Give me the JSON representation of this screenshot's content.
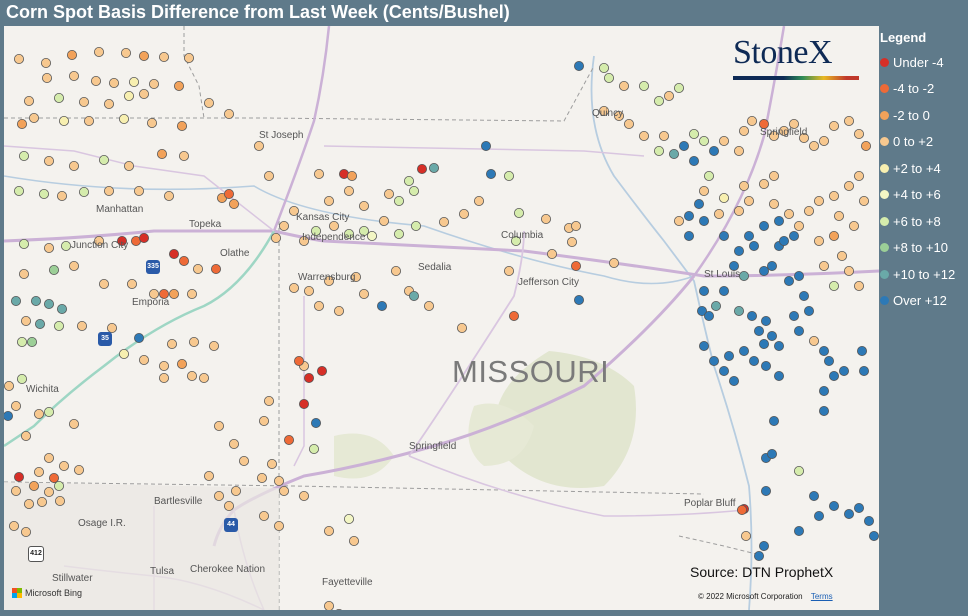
{
  "header": {
    "title": "Corn Spot Basis Difference from Last Week (Cents/Bushel)"
  },
  "brand": {
    "logo_text": "StoneX"
  },
  "legend": {
    "title": "Legend",
    "items": [
      {
        "label": "Under -4",
        "color": "#d62f27"
      },
      {
        "label": "-4 to -2",
        "color": "#ee6a37"
      },
      {
        "label": "-2 to 0",
        "color": "#f2a25a"
      },
      {
        "label": "0 to +2",
        "color": "#f7c88f"
      },
      {
        "label": "+2 to +4",
        "color": "#f7efb0"
      },
      {
        "label": "+4 to +6",
        "color": "#f3f6c4"
      },
      {
        "label": "+6 to +8",
        "color": "#d5ecac"
      },
      {
        "label": "+8 to +10",
        "color": "#9ccf97"
      },
      {
        "label": "+10 to +12",
        "color": "#6aa9a8"
      },
      {
        "label": "Over +12",
        "color": "#2d79b6"
      }
    ]
  },
  "map": {
    "state_label": "MISSOURI",
    "places": [
      {
        "name": "St Joseph"
      },
      {
        "name": "Manhattan"
      },
      {
        "name": "Topeka"
      },
      {
        "name": "Kansas City"
      },
      {
        "name": "Independence"
      },
      {
        "name": "Junction City"
      },
      {
        "name": "Olathe"
      },
      {
        "name": "Columbia"
      },
      {
        "name": "Sedalia"
      },
      {
        "name": "Warrensburg"
      },
      {
        "name": "Jefferson City"
      },
      {
        "name": "St Louis"
      },
      {
        "name": "Emporia"
      },
      {
        "name": "Springfield"
      },
      {
        "name": "Wichita"
      },
      {
        "name": "Bartlesville"
      },
      {
        "name": "Osage I.R."
      },
      {
        "name": "Poplar Bluff"
      },
      {
        "name": "Stillwater"
      },
      {
        "name": "Tulsa"
      },
      {
        "name": "Cherokee Nation"
      },
      {
        "name": "Fayetteville"
      },
      {
        "name": "Quincy"
      },
      {
        "name": "Springfield"
      }
    ],
    "shields": [
      "35",
      "335",
      "35",
      "44",
      "412"
    ],
    "source": "Source: DTN ProphetX",
    "copyright": "© 2022 Microsoft Corporation",
    "terms": "Terms",
    "attribution": "Microsoft Bing"
  },
  "sites": [
    [
      15,
      33,
      3
    ],
    [
      42,
      37,
      3
    ],
    [
      68,
      29,
      2
    ],
    [
      95,
      26,
      3
    ],
    [
      122,
      27,
      3
    ],
    [
      140,
      30,
      2
    ],
    [
      160,
      31,
      3
    ],
    [
      185,
      32,
      3
    ],
    [
      43,
      52,
      3
    ],
    [
      70,
      50,
      3
    ],
    [
      92,
      55,
      3
    ],
    [
      110,
      57,
      3
    ],
    [
      130,
      56,
      4
    ],
    [
      150,
      58,
      3
    ],
    [
      175,
      60,
      2
    ],
    [
      25,
      75,
      3
    ],
    [
      55,
      72,
      6
    ],
    [
      80,
      76,
      3
    ],
    [
      105,
      78,
      3
    ],
    [
      125,
      70,
      4
    ],
    [
      140,
      68,
      3
    ],
    [
      18,
      98,
      2
    ],
    [
      30,
      92,
      3
    ],
    [
      60,
      95,
      4
    ],
    [
      85,
      95,
      3
    ],
    [
      120,
      93,
      4
    ],
    [
      148,
      97,
      3
    ],
    [
      178,
      100,
      2
    ],
    [
      205,
      77,
      3
    ],
    [
      225,
      88,
      3
    ],
    [
      20,
      130,
      6
    ],
    [
      45,
      135,
      3
    ],
    [
      70,
      140,
      3
    ],
    [
      100,
      134,
      6
    ],
    [
      125,
      140,
      3
    ],
    [
      158,
      128,
      2
    ],
    [
      180,
      130,
      3
    ],
    [
      15,
      165,
      6
    ],
    [
      40,
      168,
      6
    ],
    [
      58,
      170,
      3
    ],
    [
      80,
      166,
      6
    ],
    [
      105,
      165,
      3
    ],
    [
      135,
      165,
      3
    ],
    [
      165,
      170,
      3
    ],
    [
      218,
      172,
      2
    ],
    [
      230,
      178,
      2
    ],
    [
      225,
      168,
      1
    ],
    [
      20,
      218,
      6
    ],
    [
      45,
      222,
      3
    ],
    [
      62,
      220,
      6
    ],
    [
      95,
      215,
      3
    ],
    [
      118,
      215,
      0
    ],
    [
      132,
      215,
      1
    ],
    [
      140,
      212,
      0
    ],
    [
      170,
      228,
      0
    ],
    [
      180,
      235,
      1
    ],
    [
      212,
      243,
      1
    ],
    [
      194,
      243,
      3
    ],
    [
      20,
      248,
      3
    ],
    [
      50,
      244,
      7
    ],
    [
      70,
      240,
      3
    ],
    [
      100,
      258,
      3
    ],
    [
      128,
      258,
      3
    ],
    [
      150,
      268,
      3
    ],
    [
      160,
      268,
      1
    ],
    [
      170,
      268,
      2
    ],
    [
      188,
      268,
      3
    ],
    [
      12,
      275,
      8
    ],
    [
      32,
      275,
      8
    ],
    [
      45,
      278,
      8
    ],
    [
      58,
      283,
      8
    ],
    [
      22,
      295,
      3
    ],
    [
      36,
      298,
      8
    ],
    [
      55,
      300,
      6
    ],
    [
      78,
      300,
      3
    ],
    [
      108,
      302,
      3
    ],
    [
      18,
      316,
      6
    ],
    [
      28,
      316,
      7
    ],
    [
      135,
      312,
      9
    ],
    [
      168,
      318,
      3
    ],
    [
      190,
      316,
      3
    ],
    [
      210,
      320,
      3
    ],
    [
      120,
      328,
      4
    ],
    [
      140,
      334,
      3
    ],
    [
      160,
      340,
      3
    ],
    [
      178,
      338,
      2
    ],
    [
      188,
      350,
      3
    ],
    [
      160,
      352,
      3
    ],
    [
      200,
      352,
      3
    ],
    [
      5,
      360,
      3
    ],
    [
      18,
      353,
      6
    ],
    [
      12,
      380,
      3
    ],
    [
      35,
      388,
      3
    ],
    [
      45,
      386,
      6
    ],
    [
      70,
      398,
      3
    ],
    [
      22,
      410,
      3
    ],
    [
      45,
      432,
      3
    ],
    [
      60,
      440,
      3
    ],
    [
      75,
      444,
      3
    ],
    [
      35,
      446,
      3
    ],
    [
      50,
      452,
      1
    ],
    [
      15,
      451,
      0
    ],
    [
      30,
      460,
      2
    ],
    [
      12,
      465,
      3
    ],
    [
      45,
      466,
      3
    ],
    [
      55,
      460,
      6
    ],
    [
      25,
      478,
      3
    ],
    [
      38,
      476,
      3
    ],
    [
      56,
      475,
      3
    ],
    [
      10,
      500,
      3
    ],
    [
      22,
      506,
      3
    ],
    [
      4,
      390,
      9
    ],
    [
      255,
      120,
      3
    ],
    [
      265,
      150,
      3
    ],
    [
      315,
      148,
      3
    ],
    [
      340,
      148,
      0
    ],
    [
      348,
      150,
      2
    ],
    [
      345,
      165,
      3
    ],
    [
      405,
      155,
      6
    ],
    [
      418,
      143,
      0
    ],
    [
      430,
      142,
      8
    ],
    [
      410,
      165,
      6
    ],
    [
      395,
      175,
      6
    ],
    [
      385,
      168,
      3
    ],
    [
      360,
      180,
      3
    ],
    [
      325,
      175,
      3
    ],
    [
      290,
      185,
      3
    ],
    [
      272,
      212,
      3
    ],
    [
      280,
      200,
      3
    ],
    [
      300,
      215,
      3
    ],
    [
      312,
      205,
      6
    ],
    [
      330,
      200,
      3
    ],
    [
      345,
      208,
      6
    ],
    [
      360,
      205,
      6
    ],
    [
      368,
      210,
      5
    ],
    [
      380,
      195,
      3
    ],
    [
      395,
      208,
      6
    ],
    [
      412,
      200,
      6
    ],
    [
      440,
      196,
      3
    ],
    [
      460,
      188,
      3
    ],
    [
      482,
      120,
      9
    ],
    [
      505,
      150,
      6
    ],
    [
      487,
      148,
      9
    ],
    [
      475,
      175,
      3
    ],
    [
      515,
      187,
      6
    ],
    [
      542,
      193,
      3
    ],
    [
      565,
      202,
      3
    ],
    [
      572,
      200,
      3
    ],
    [
      548,
      228,
      3
    ],
    [
      568,
      216,
      3
    ],
    [
      572,
      240,
      1
    ],
    [
      512,
      215,
      6
    ],
    [
      505,
      245,
      3
    ],
    [
      392,
      245,
      3
    ],
    [
      352,
      251,
      3
    ],
    [
      325,
      255,
      3
    ],
    [
      305,
      265,
      3
    ],
    [
      290,
      262,
      3
    ],
    [
      315,
      280,
      3
    ],
    [
      335,
      285,
      3
    ],
    [
      360,
      268,
      3
    ],
    [
      378,
      280,
      9
    ],
    [
      405,
      265,
      3
    ],
    [
      410,
      270,
      8
    ],
    [
      425,
      280,
      3
    ],
    [
      458,
      302,
      3
    ],
    [
      510,
      290,
      1
    ],
    [
      575,
      274,
      9
    ],
    [
      610,
      237,
      3
    ],
    [
      300,
      340,
      3
    ],
    [
      295,
      335,
      1
    ],
    [
      318,
      345,
      0
    ],
    [
      305,
      352,
      0
    ],
    [
      300,
      378,
      0
    ],
    [
      312,
      397,
      9
    ],
    [
      285,
      414,
      1
    ],
    [
      310,
      423,
      6
    ],
    [
      260,
      395,
      3
    ],
    [
      265,
      375,
      3
    ],
    [
      268,
      438,
      3
    ],
    [
      258,
      452,
      3
    ],
    [
      240,
      435,
      3
    ],
    [
      230,
      418,
      3
    ],
    [
      215,
      400,
      3
    ],
    [
      205,
      450,
      3
    ],
    [
      215,
      470,
      3
    ],
    [
      225,
      480,
      3
    ],
    [
      232,
      465,
      3
    ],
    [
      275,
      455,
      3
    ],
    [
      280,
      465,
      3
    ],
    [
      300,
      470,
      3
    ],
    [
      260,
      490,
      3
    ],
    [
      275,
      500,
      3
    ],
    [
      325,
      505,
      3
    ],
    [
      345,
      493,
      5
    ],
    [
      350,
      515,
      3
    ],
    [
      325,
      580,
      3
    ],
    [
      335,
      588,
      3
    ],
    [
      575,
      40,
      9
    ],
    [
      600,
      42,
      6
    ],
    [
      605,
      52,
      6
    ],
    [
      620,
      60,
      3
    ],
    [
      640,
      60,
      6
    ],
    [
      655,
      75,
      6
    ],
    [
      665,
      70,
      3
    ],
    [
      675,
      62,
      6
    ],
    [
      600,
      85,
      3
    ],
    [
      615,
      90,
      3
    ],
    [
      625,
      98,
      3
    ],
    [
      640,
      110,
      3
    ],
    [
      660,
      110,
      3
    ],
    [
      655,
      125,
      6
    ],
    [
      670,
      128,
      8
    ],
    [
      680,
      120,
      9
    ],
    [
      690,
      108,
      6
    ],
    [
      700,
      115,
      6
    ],
    [
      710,
      125,
      9
    ],
    [
      720,
      115,
      3
    ],
    [
      735,
      125,
      3
    ],
    [
      740,
      105,
      3
    ],
    [
      748,
      95,
      3
    ],
    [
      760,
      98,
      1
    ],
    [
      770,
      110,
      3
    ],
    [
      780,
      105,
      3
    ],
    [
      790,
      98,
      3
    ],
    [
      800,
      112,
      3
    ],
    [
      810,
      120,
      3
    ],
    [
      820,
      115,
      3
    ],
    [
      830,
      100,
      3
    ],
    [
      845,
      95,
      3
    ],
    [
      855,
      108,
      3
    ],
    [
      862,
      120,
      2
    ],
    [
      690,
      135,
      9
    ],
    [
      705,
      150,
      6
    ],
    [
      700,
      165,
      3
    ],
    [
      695,
      178,
      9
    ],
    [
      685,
      190,
      9
    ],
    [
      675,
      195,
      3
    ],
    [
      700,
      195,
      9
    ],
    [
      715,
      188,
      3
    ],
    [
      720,
      172,
      4
    ],
    [
      740,
      160,
      3
    ],
    [
      745,
      175,
      3
    ],
    [
      735,
      185,
      3
    ],
    [
      760,
      158,
      3
    ],
    [
      770,
      150,
      3
    ],
    [
      770,
      178,
      3
    ],
    [
      760,
      200,
      9
    ],
    [
      775,
      195,
      9
    ],
    [
      785,
      188,
      3
    ],
    [
      795,
      200,
      3
    ],
    [
      805,
      185,
      3
    ],
    [
      815,
      175,
      3
    ],
    [
      830,
      170,
      3
    ],
    [
      845,
      160,
      3
    ],
    [
      855,
      150,
      3
    ],
    [
      860,
      175,
      3
    ],
    [
      835,
      190,
      3
    ],
    [
      850,
      200,
      3
    ],
    [
      830,
      210,
      2
    ],
    [
      815,
      215,
      3
    ],
    [
      685,
      210,
      9
    ],
    [
      720,
      210,
      9
    ],
    [
      735,
      225,
      9
    ],
    [
      745,
      210,
      9
    ],
    [
      750,
      220,
      9
    ],
    [
      730,
      240,
      9
    ],
    [
      740,
      250,
      8
    ],
    [
      760,
      245,
      9
    ],
    [
      768,
      240,
      9
    ],
    [
      775,
      220,
      9
    ],
    [
      780,
      215,
      9
    ],
    [
      790,
      210,
      9
    ],
    [
      785,
      255,
      9
    ],
    [
      795,
      250,
      9
    ],
    [
      820,
      240,
      3
    ],
    [
      838,
      230,
      3
    ],
    [
      845,
      245,
      3
    ],
    [
      855,
      260,
      3
    ],
    [
      830,
      260,
      6
    ],
    [
      800,
      270,
      9
    ],
    [
      805,
      285,
      9
    ],
    [
      790,
      290,
      9
    ],
    [
      795,
      305,
      9
    ],
    [
      810,
      315,
      3
    ],
    [
      720,
      265,
      9
    ],
    [
      700,
      265,
      9
    ],
    [
      698,
      285,
      9
    ],
    [
      705,
      290,
      9
    ],
    [
      712,
      280,
      8
    ],
    [
      735,
      285,
      8
    ],
    [
      748,
      290,
      9
    ],
    [
      762,
      295,
      9
    ],
    [
      755,
      305,
      9
    ],
    [
      768,
      310,
      9
    ],
    [
      775,
      320,
      9
    ],
    [
      760,
      318,
      9
    ],
    [
      700,
      320,
      9
    ],
    [
      710,
      335,
      9
    ],
    [
      720,
      345,
      9
    ],
    [
      725,
      330,
      9
    ],
    [
      740,
      325,
      9
    ],
    [
      750,
      335,
      9
    ],
    [
      762,
      340,
      9
    ],
    [
      775,
      350,
      9
    ],
    [
      730,
      355,
      9
    ],
    [
      820,
      325,
      9
    ],
    [
      825,
      335,
      9
    ],
    [
      830,
      350,
      9
    ],
    [
      840,
      345,
      9
    ],
    [
      820,
      365,
      9
    ],
    [
      858,
      325,
      9
    ],
    [
      860,
      345,
      9
    ],
    [
      820,
      385,
      9
    ],
    [
      770,
      395,
      9
    ],
    [
      762,
      432,
      9
    ],
    [
      768,
      428,
      9
    ],
    [
      762,
      465,
      9
    ],
    [
      795,
      445,
      6
    ],
    [
      810,
      470,
      9
    ],
    [
      815,
      490,
      9
    ],
    [
      795,
      505,
      9
    ],
    [
      830,
      480,
      9
    ],
    [
      845,
      488,
      9
    ],
    [
      855,
      482,
      9
    ],
    [
      865,
      495,
      9
    ],
    [
      870,
      510,
      9
    ],
    [
      760,
      520,
      9
    ],
    [
      755,
      530,
      9
    ],
    [
      740,
      483,
      0
    ],
    [
      738,
      484,
      1
    ],
    [
      742,
      510,
      3
    ]
  ]
}
